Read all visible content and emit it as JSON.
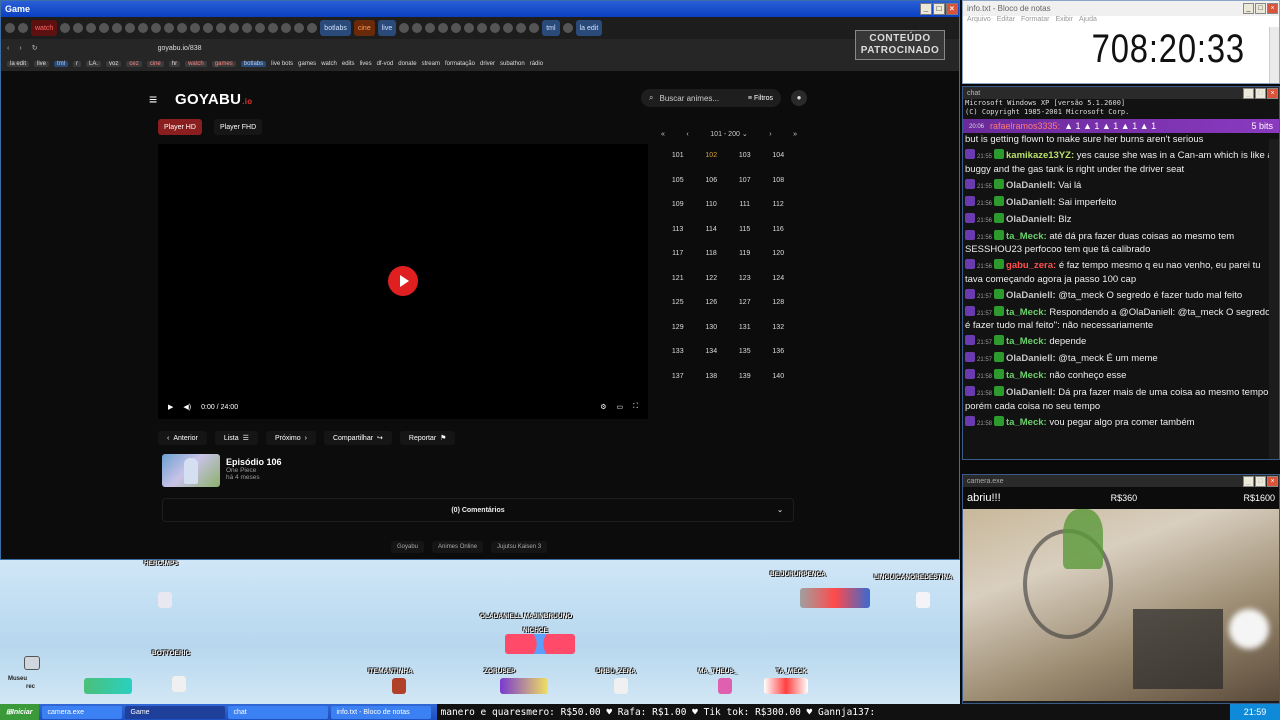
{
  "game_window": {
    "title": "Game",
    "tabs": [
      "watch",
      "botlabs",
      "cine",
      "live",
      "tml",
      "la edit"
    ],
    "url": "goyabu.io/838",
    "bookmarks": [
      "la edit",
      "live",
      "tml",
      "r",
      "LA.",
      "voz",
      "cez",
      "cine",
      "hr",
      "watch",
      "games",
      "botlabs",
      "live bots",
      "games",
      "watch",
      "edits",
      "lives",
      "df-vod",
      "donate",
      "stream",
      "formatação",
      "driver",
      "subathon",
      "rádio"
    ],
    "sponsor_label_line1": "CONTEÚDO",
    "sponsor_label_line2": "PATROCINADO"
  },
  "goyabu": {
    "logo": "GOYABU",
    "logo_suffix": ".io",
    "search_placeholder": "Buscar animes...",
    "filters_label": "Filtros",
    "player_buttons": [
      "Player HD",
      "Player FHD"
    ],
    "player_time": "0:00 / 24:00",
    "range_label": "101 - 200",
    "episodes": [
      "101",
      "102",
      "103",
      "104",
      "105",
      "106",
      "107",
      "108",
      "109",
      "110",
      "111",
      "112",
      "113",
      "114",
      "115",
      "116",
      "117",
      "118",
      "119",
      "120",
      "121",
      "122",
      "123",
      "124",
      "125",
      "126",
      "127",
      "128",
      "129",
      "130",
      "131",
      "132",
      "133",
      "134",
      "135",
      "136",
      "137",
      "138",
      "139",
      "140"
    ],
    "actions": [
      "Anterior",
      "Lista",
      "Próximo",
      "Compartilhar",
      "Reportar"
    ],
    "episode_title": "Episódio 106",
    "episode_series": "One Piece",
    "episode_age": "há 4 meses",
    "comments_label": "(0) Comentários",
    "footer_tags": [
      "Goyabu",
      "Animes Online",
      "Jujutsu Kaisen 3"
    ]
  },
  "game_overlay": {
    "names": [
      "HERO.MP3",
      "BOTTOERIC",
      "OLADANIELL MAJINBRUUNO",
      "NICHCE",
      "BEIJURURPENCA",
      "LINGUICANOREDESTINA",
      "ITEMANTINHA",
      "ZORUSEP",
      "DRBU_ZERA",
      "MA_THEUS_",
      "TA_MECK"
    ],
    "left_label_1": "Museu",
    "left_label_2": "rec"
  },
  "notepad": {
    "title": "info.txt - Bloco de notas",
    "menu": [
      "Arquivo",
      "Editar",
      "Formatar",
      "Exibir",
      "Ajuda"
    ],
    "timer": "708:20:33"
  },
  "chat": {
    "title": "chat",
    "sys_line1": "Microsoft Windows XP [versão 5.1.2600]",
    "sys_line2": "(C) Copyright 1985-2001 Microsoft Corp.",
    "bits_time": "20:06",
    "bits_user": "rafaelramos3335:",
    "bits_amount": "5 bits",
    "messages": [
      {
        "time": "",
        "user": "",
        "ucls": "",
        "text": "but is getting flown to make sure her burns aren't serious"
      },
      {
        "time": "21:55",
        "user": "kamikaze13YZ:",
        "ucls": "u-kami",
        "text": "yes cause she was in a Can-am which is like a buggy and the gas tank is right under the driver seat"
      },
      {
        "time": "21:55",
        "user": "OlaDaniell:",
        "ucls": "u-ola",
        "text": "Vai lá"
      },
      {
        "time": "21:56",
        "user": "OlaDaniell:",
        "ucls": "u-ola",
        "text": "Sai imperfeito"
      },
      {
        "time": "21:56",
        "user": "OlaDaniell:",
        "ucls": "u-ola",
        "text": "Blz"
      },
      {
        "time": "21:56",
        "user": "ta_Meck:",
        "ucls": "u-ta",
        "text": "até dá pra fazer duas coisas ao mesmo tem SESSHOU23 perfocoo tem que tá calibrado"
      },
      {
        "time": "21:56",
        "user": "gabu_zera:",
        "ucls": "u-gab",
        "text": "é faz tempo mesmo q eu nao venho, eu parei tu tava começando agora ja passo 100 cap"
      },
      {
        "time": "21:57",
        "user": "OlaDaniell:",
        "ucls": "u-ola",
        "text": "@ta_meck O segredo é fazer tudo mal feito"
      },
      {
        "time": "21:57",
        "user": "ta_Meck:",
        "ucls": "u-ta",
        "text": "Respondendo a @OlaDaniell: @ta_meck O segredo é fazer tudo mal feito\": não necessariamente"
      },
      {
        "time": "21:57",
        "user": "ta_Meck:",
        "ucls": "u-ta",
        "text": "depende"
      },
      {
        "time": "21:57",
        "user": "OlaDaniell:",
        "ucls": "u-ola",
        "text": "@ta_meck É um meme"
      },
      {
        "time": "21:58",
        "user": "ta_Meck:",
        "ucls": "u-ta",
        "text": "não conheço esse"
      },
      {
        "time": "21:58",
        "user": "OlaDaniell:",
        "ucls": "u-ola",
        "text": "Dá pra fazer mais de uma coisa ao mesmo tempo, porém cada coisa no seu tempo"
      },
      {
        "time": "21:58",
        "user": "ta_Meck:",
        "ucls": "u-ta",
        "text": "vou pegar algo pra comer também"
      }
    ]
  },
  "camera": {
    "title": "camera.exe",
    "abriu": "abriu!!!",
    "price1": "R$360",
    "price2": "R$1600"
  },
  "taskbar": {
    "start": "Iniciar",
    "items": [
      "camera.exe",
      "Game",
      "chat",
      "info.txt - Bloco de notas"
    ],
    "ticker": "manero e quaresmero: R$50.00  ♥  Rafa: R$1.00  ♥  Tik tok: R$300.00  ♥  Gannja137:",
    "clock": "21:59"
  }
}
